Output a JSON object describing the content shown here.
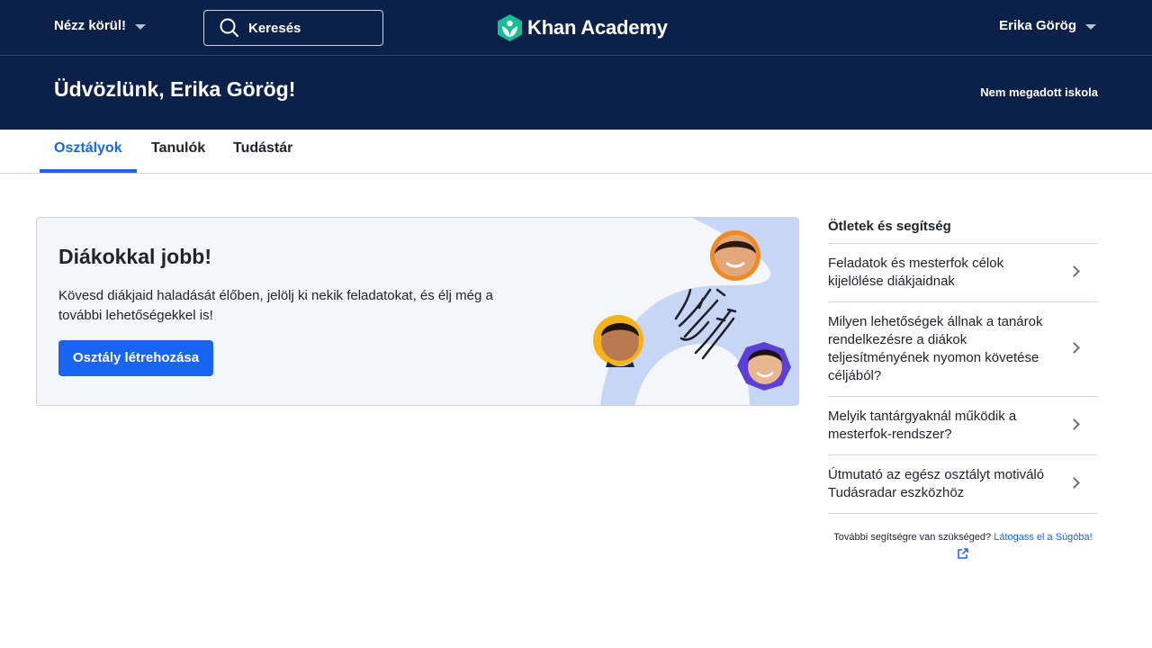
{
  "nav": {
    "explore_label": "Nézz körül!",
    "search_placeholder": "Keresés",
    "logo_text": "Khan Academy",
    "user_name": "Erika Görög"
  },
  "hero": {
    "welcome": "Üdvözlünk, Erika Görög!",
    "school": "Nem megadott iskola"
  },
  "tabs": [
    {
      "label": "Osztályok",
      "active": true
    },
    {
      "label": "Tanulók",
      "active": false
    },
    {
      "label": "Tudástár",
      "active": false
    }
  ],
  "card": {
    "title": "Diákokkal jobb!",
    "text": "Kövesd diákjaid haladását élőben, jelölj ki nekik feladatokat, és élj még a további lehetőségekkel is!",
    "button": "Osztály létrehozása"
  },
  "sidebar": {
    "title": "Ötletek és segítség",
    "items": [
      {
        "label": "Feladatok és mesterfok célok kijelölése diákjaidnak"
      },
      {
        "label": "Milyen lehetőségek állnak a tanárok rendelkezésre a diákok teljesítményének nyomon követése céljából?"
      },
      {
        "label": "Melyik tantárgyaknál működik a mesterfok-rendszer?"
      },
      {
        "label": "Útmutató az egész osztályt motiváló Tudásradar eszközhöz"
      }
    ],
    "footer_text": "További segítségre van szükséged?",
    "footer_link": "Látogass el a Súgóba!"
  },
  "colors": {
    "navy": "#0b2149",
    "accent": "#1865f2",
    "logo_green": "#14bf96"
  }
}
